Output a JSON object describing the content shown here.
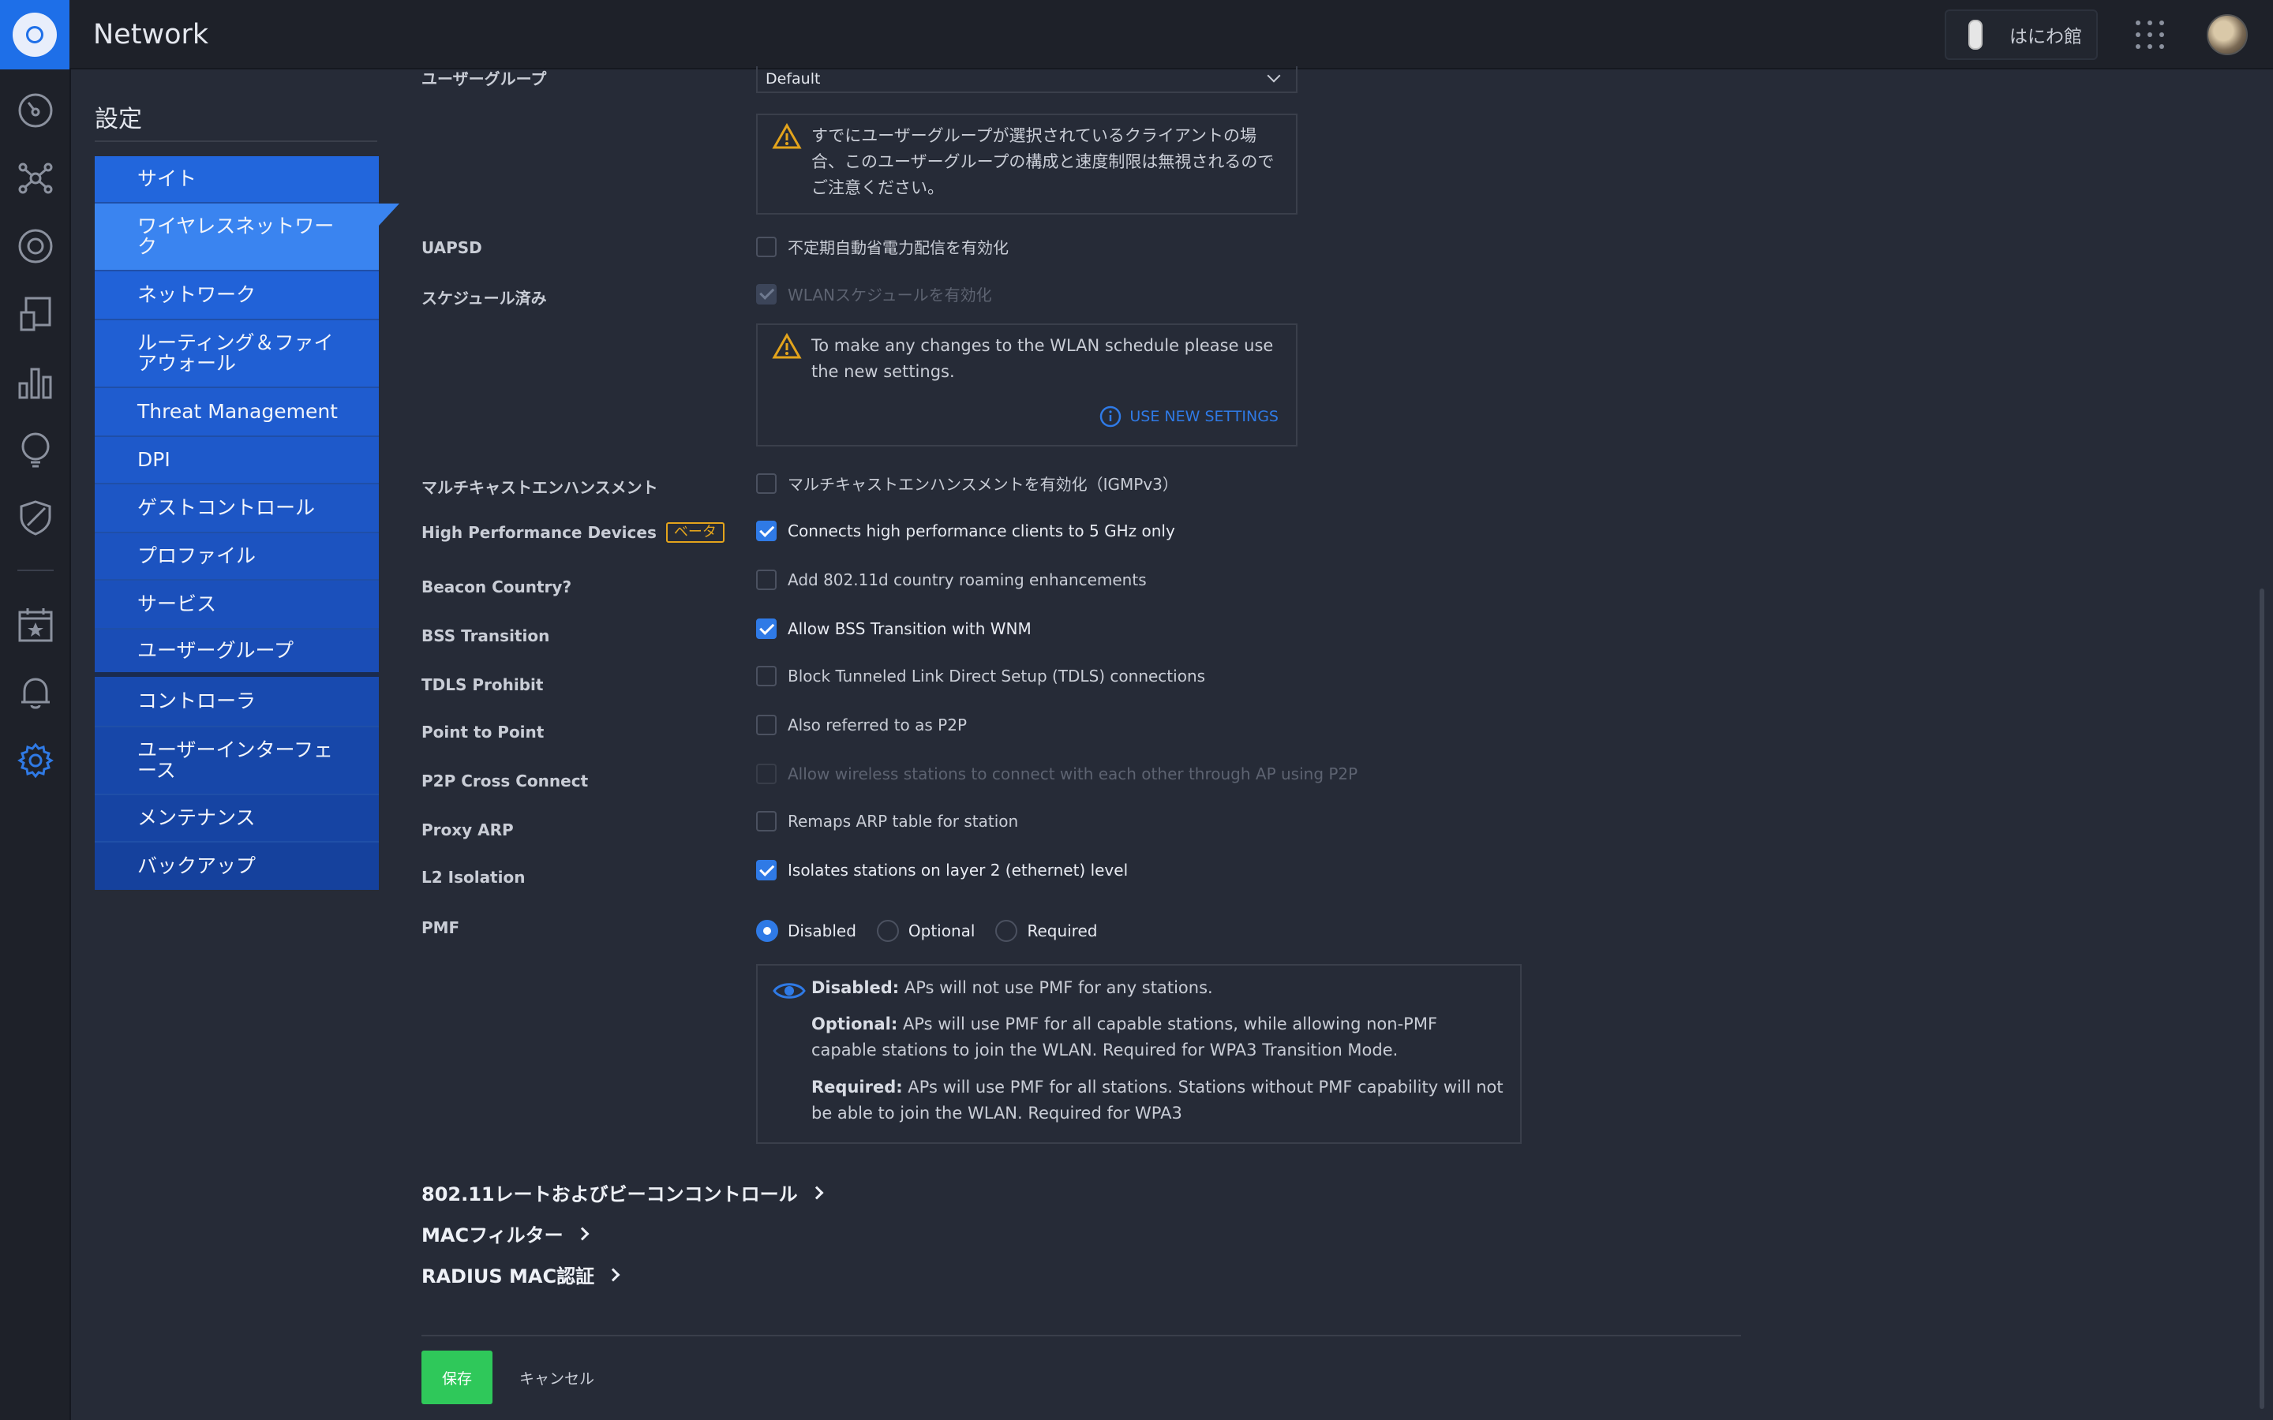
{
  "header": {
    "app_title": "Network",
    "site_name": "はにわ館"
  },
  "sidebar": {
    "settings_title": "設定",
    "items": [
      {
        "label": "サイト"
      },
      {
        "label": "ワイヤレスネットワーク",
        "active": true
      },
      {
        "label": "ネットワーク"
      },
      {
        "label": "ルーティング＆ファイアウォール"
      },
      {
        "label": "Threat Management"
      },
      {
        "label": "DPI"
      },
      {
        "label": "ゲストコントロール"
      },
      {
        "label": "プロファイル"
      },
      {
        "label": "サービス"
      },
      {
        "label": "ユーザーグループ"
      },
      {
        "label": "コントローラ"
      },
      {
        "label": "ユーザーインターフェース"
      },
      {
        "label": "メンテナンス"
      },
      {
        "label": "バックアップ"
      }
    ]
  },
  "form": {
    "user_group_label": "ユーザーグループ",
    "user_group_value": "Default",
    "user_group_warning": "すでにユーザーグループが選択されているクライアントの場合、このユーザーグループの構成と速度制限は無視されるのでご注意ください。",
    "uapsd_label": "UAPSD",
    "uapsd_text": "不定期自動省電力配信を有効化",
    "schedule_label": "スケジュール済み",
    "schedule_text": "WLANスケジュールを有効化",
    "schedule_warning": "To make any changes to the WLAN schedule please use the new settings.",
    "use_new_settings": "USE NEW SETTINGS",
    "multicast_label": "マルチキャストエンハンスメント",
    "multicast_text": "マルチキャストエンハンスメントを有効化（IGMPv3）",
    "hpd_label": "High Performance Devices",
    "beta_badge": "ベータ",
    "hpd_text": "Connects high performance clients to 5 GHz only",
    "beacon_label": "Beacon Country?",
    "beacon_text": "Add 802.11d country roaming enhancements",
    "bss_label": "BSS Transition",
    "bss_text": "Allow BSS Transition with WNM",
    "tdls_label": "TDLS Prohibit",
    "tdls_text": "Block Tunneled Link Direct Setup (TDLS) connections",
    "p2p_label": "Point to Point",
    "p2p_text": "Also referred to as P2P",
    "p2pcc_label": "P2P Cross Connect",
    "p2pcc_text": "Allow wireless stations to connect with each other through AP using P2P",
    "proxyarp_label": "Proxy ARP",
    "proxyarp_text": "Remaps ARP table for station",
    "l2_label": "L2 Isolation",
    "l2_text": "Isolates stations on layer 2 (ethernet) level",
    "pmf_label": "PMF",
    "pmf_options": [
      "Disabled",
      "Optional",
      "Required"
    ],
    "pmf_selected": "Disabled",
    "pmf_info": {
      "disabled_key": "Disabled:",
      "disabled_text": " APs will not use PMF for any stations.",
      "optional_key": "Optional:",
      "optional_text": " APs will use PMF for all capable stations, while allowing non-PMF capable stations to join the WLAN. Required for WPA3 Transition Mode.",
      "required_key": "Required:",
      "required_text": " APs will use PMF for all stations. Stations without PMF capability will not be able to join the WLAN. Required for WPA3"
    }
  },
  "sections": {
    "rate_beacon": "802.11レートおよびビーコンコントロール",
    "mac_filter": "MACフィルター",
    "radius_mac": "RADIUS MAC認証"
  },
  "footer": {
    "save_label": "保存",
    "cancel_label": "キャンセル"
  },
  "colors": {
    "accent": "#2f7ae6",
    "nav_bg": "#1f5fd6",
    "save": "#2fc85a",
    "warning": "#e3a41c"
  }
}
